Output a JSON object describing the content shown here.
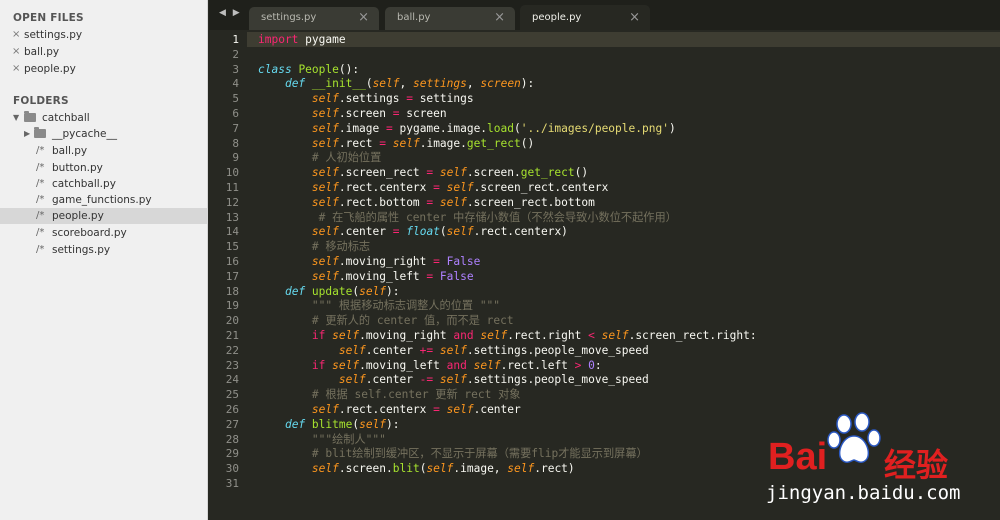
{
  "sidebar": {
    "open_files_heading": "OPEN FILES",
    "open_files": [
      "settings.py",
      "ball.py",
      "people.py"
    ],
    "folders_heading": "FOLDERS",
    "root_folder": "catchball",
    "subfolder": "__pycache__",
    "files": [
      "ball.py",
      "button.py",
      "catchball.py",
      "game_functions.py",
      "people.py",
      "scoreboard.py",
      "settings.py"
    ],
    "selected_file": "people.py"
  },
  "tabs": [
    {
      "label": "settings.py",
      "close": "×"
    },
    {
      "label": "ball.py",
      "close": "×"
    },
    {
      "label": "people.py",
      "close": "×",
      "active": true
    }
  ],
  "nav_arrows": "◀ ▶",
  "editor": {
    "current_line": 1,
    "line_numbers": [
      "1",
      "2",
      "3",
      "4",
      "5",
      "6",
      "7",
      "8",
      "9",
      "10",
      "11",
      "12",
      "13",
      "14",
      "15",
      "16",
      "17",
      "18",
      "19",
      "20",
      "21",
      "22",
      "23",
      "24",
      "25",
      "26",
      "27",
      "28",
      "29",
      "30",
      "31"
    ],
    "lines": [
      [
        {
          "t": "import",
          "c": "kw"
        },
        {
          "t": " pygame"
        }
      ],
      [],
      [
        {
          "t": "class",
          "c": "st"
        },
        {
          "t": " "
        },
        {
          "t": "People",
          "c": "fn"
        },
        {
          "t": "():"
        }
      ],
      [
        {
          "t": "    "
        },
        {
          "t": "def",
          "c": "st"
        },
        {
          "t": " "
        },
        {
          "t": "__init__",
          "c": "fn"
        },
        {
          "t": "("
        },
        {
          "t": "self",
          "c": "sf"
        },
        {
          "t": ", "
        },
        {
          "t": "settings",
          "c": "sf"
        },
        {
          "t": ", "
        },
        {
          "t": "screen",
          "c": "sf"
        },
        {
          "t": "):"
        }
      ],
      [
        {
          "t": "        "
        },
        {
          "t": "self",
          "c": "sf"
        },
        {
          "t": ".settings "
        },
        {
          "t": "=",
          "c": "kw"
        },
        {
          "t": " settings"
        }
      ],
      [
        {
          "t": "        "
        },
        {
          "t": "self",
          "c": "sf"
        },
        {
          "t": ".screen "
        },
        {
          "t": "=",
          "c": "kw"
        },
        {
          "t": " screen"
        }
      ],
      [
        {
          "t": "        "
        },
        {
          "t": "self",
          "c": "sf"
        },
        {
          "t": ".image "
        },
        {
          "t": "=",
          "c": "kw"
        },
        {
          "t": " pygame.image."
        },
        {
          "t": "load",
          "c": "fn"
        },
        {
          "t": "("
        },
        {
          "t": "'../images/people.png'",
          "c": "str"
        },
        {
          "t": ")"
        }
      ],
      [
        {
          "t": "        "
        },
        {
          "t": "self",
          "c": "sf"
        },
        {
          "t": ".rect "
        },
        {
          "t": "=",
          "c": "kw"
        },
        {
          "t": " "
        },
        {
          "t": "self",
          "c": "sf"
        },
        {
          "t": ".image."
        },
        {
          "t": "get_rect",
          "c": "fn"
        },
        {
          "t": "()"
        }
      ],
      [
        {
          "t": "        "
        },
        {
          "t": "# 人初始位置",
          "c": "cm"
        }
      ],
      [
        {
          "t": "        "
        },
        {
          "t": "self",
          "c": "sf"
        },
        {
          "t": ".screen_rect "
        },
        {
          "t": "=",
          "c": "kw"
        },
        {
          "t": " "
        },
        {
          "t": "self",
          "c": "sf"
        },
        {
          "t": ".screen."
        },
        {
          "t": "get_rect",
          "c": "fn"
        },
        {
          "t": "()"
        }
      ],
      [
        {
          "t": "        "
        },
        {
          "t": "self",
          "c": "sf"
        },
        {
          "t": ".rect.centerx "
        },
        {
          "t": "=",
          "c": "kw"
        },
        {
          "t": " "
        },
        {
          "t": "self",
          "c": "sf"
        },
        {
          "t": ".screen_rect.centerx"
        }
      ],
      [
        {
          "t": "        "
        },
        {
          "t": "self",
          "c": "sf"
        },
        {
          "t": ".rect.bottom "
        },
        {
          "t": "=",
          "c": "kw"
        },
        {
          "t": " "
        },
        {
          "t": "self",
          "c": "sf"
        },
        {
          "t": ".screen_rect.bottom"
        }
      ],
      [
        {
          "t": "         "
        },
        {
          "t": "# 在飞船的属性 center 中存储小数值（不然会导致小数位不起作用）",
          "c": "cm"
        }
      ],
      [
        {
          "t": "        "
        },
        {
          "t": "self",
          "c": "sf"
        },
        {
          "t": ".center "
        },
        {
          "t": "=",
          "c": "kw"
        },
        {
          "t": " "
        },
        {
          "t": "float",
          "c": "st"
        },
        {
          "t": "("
        },
        {
          "t": "self",
          "c": "sf"
        },
        {
          "t": ".rect.centerx)"
        }
      ],
      [
        {
          "t": "        "
        },
        {
          "t": "# 移动标志",
          "c": "cm"
        }
      ],
      [
        {
          "t": "        "
        },
        {
          "t": "self",
          "c": "sf"
        },
        {
          "t": ".moving_right "
        },
        {
          "t": "=",
          "c": "kw"
        },
        {
          "t": " "
        },
        {
          "t": "False",
          "c": "cst"
        }
      ],
      [
        {
          "t": "        "
        },
        {
          "t": "self",
          "c": "sf"
        },
        {
          "t": ".moving_left "
        },
        {
          "t": "=",
          "c": "kw"
        },
        {
          "t": " "
        },
        {
          "t": "False",
          "c": "cst"
        }
      ],
      [
        {
          "t": "    "
        },
        {
          "t": "def",
          "c": "st"
        },
        {
          "t": " "
        },
        {
          "t": "update",
          "c": "fn"
        },
        {
          "t": "("
        },
        {
          "t": "self",
          "c": "sf"
        },
        {
          "t": "):"
        }
      ],
      [
        {
          "t": "        "
        },
        {
          "t": "\"\"\" 根据移动标志调整人的位置 \"\"\"",
          "c": "cm"
        }
      ],
      [
        {
          "t": "        "
        },
        {
          "t": "# 更新人的 center 值，而不是 rect",
          "c": "cm"
        }
      ],
      [
        {
          "t": "        "
        },
        {
          "t": "if",
          "c": "kw"
        },
        {
          "t": " "
        },
        {
          "t": "self",
          "c": "sf"
        },
        {
          "t": ".moving_right "
        },
        {
          "t": "and",
          "c": "kw"
        },
        {
          "t": " "
        },
        {
          "t": "self",
          "c": "sf"
        },
        {
          "t": ".rect.right "
        },
        {
          "t": "<",
          "c": "kw"
        },
        {
          "t": " "
        },
        {
          "t": "self",
          "c": "sf"
        },
        {
          "t": ".screen_rect.right:"
        }
      ],
      [
        {
          "t": "            "
        },
        {
          "t": "self",
          "c": "sf"
        },
        {
          "t": ".center "
        },
        {
          "t": "+=",
          "c": "kw"
        },
        {
          "t": " "
        },
        {
          "t": "self",
          "c": "sf"
        },
        {
          "t": ".settings.people_move_speed"
        }
      ],
      [
        {
          "t": "        "
        },
        {
          "t": "if",
          "c": "kw"
        },
        {
          "t": " "
        },
        {
          "t": "self",
          "c": "sf"
        },
        {
          "t": ".moving_left "
        },
        {
          "t": "and",
          "c": "kw"
        },
        {
          "t": " "
        },
        {
          "t": "self",
          "c": "sf"
        },
        {
          "t": ".rect.left "
        },
        {
          "t": ">",
          "c": "kw"
        },
        {
          "t": " "
        },
        {
          "t": "0",
          "c": "cst"
        },
        {
          "t": ":"
        }
      ],
      [
        {
          "t": "            "
        },
        {
          "t": "self",
          "c": "sf"
        },
        {
          "t": ".center "
        },
        {
          "t": "-=",
          "c": "kw"
        },
        {
          "t": " "
        },
        {
          "t": "self",
          "c": "sf"
        },
        {
          "t": ".settings.people_move_speed"
        }
      ],
      [
        {
          "t": "        "
        },
        {
          "t": "# 根据 self.center 更新 rect 对象",
          "c": "cm"
        }
      ],
      [
        {
          "t": "        "
        },
        {
          "t": "self",
          "c": "sf"
        },
        {
          "t": ".rect.centerx "
        },
        {
          "t": "=",
          "c": "kw"
        },
        {
          "t": " "
        },
        {
          "t": "self",
          "c": "sf"
        },
        {
          "t": ".center"
        }
      ],
      [
        {
          "t": "    "
        },
        {
          "t": "def",
          "c": "st"
        },
        {
          "t": " "
        },
        {
          "t": "blitme",
          "c": "fn"
        },
        {
          "t": "("
        },
        {
          "t": "self",
          "c": "sf"
        },
        {
          "t": "):"
        }
      ],
      [
        {
          "t": "        "
        },
        {
          "t": "\"\"\"绘制人\"\"\"",
          "c": "cm"
        }
      ],
      [
        {
          "t": "        "
        },
        {
          "t": "# blit绘制到缓冲区，不显示于屏幕（需要flip才能显示到屏幕）",
          "c": "cm"
        }
      ],
      [
        {
          "t": "        "
        },
        {
          "t": "self",
          "c": "sf"
        },
        {
          "t": ".screen."
        },
        {
          "t": "blit",
          "c": "fn"
        },
        {
          "t": "("
        },
        {
          "t": "self",
          "c": "sf"
        },
        {
          "t": ".image, "
        },
        {
          "t": "self",
          "c": "sf"
        },
        {
          "t": ".rect)"
        }
      ],
      []
    ]
  },
  "watermark": {
    "logo_text": "Bai",
    "logo_text2": "经验",
    "url": "jingyan.baidu.com",
    "colors": {
      "red": "#e02020",
      "blue": "#2b59c3"
    }
  },
  "colors": {
    "editor_bg": "#272822",
    "sidebar_bg": "#f0f0f0",
    "keyword": "#f92672",
    "storage": "#66d9ef",
    "function": "#a6e22e",
    "string": "#e6db74",
    "comment": "#75715e",
    "constant": "#ae81ff",
    "param": "#fd971f"
  }
}
